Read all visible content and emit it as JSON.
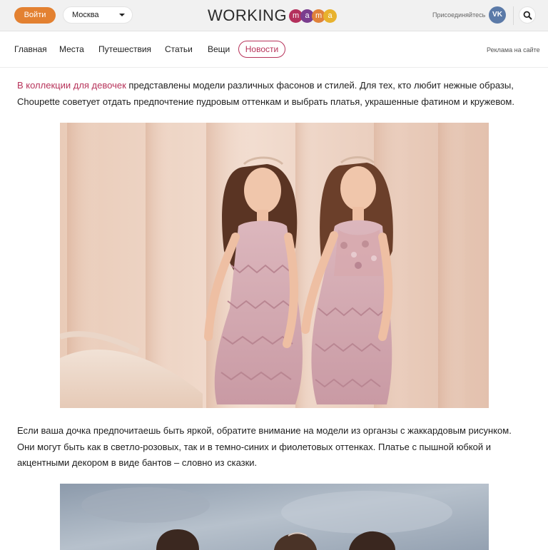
{
  "header": {
    "login_label": "Войти",
    "city_value": "Москва",
    "logo_word": "WORKING",
    "logo_letters": [
      "m",
      "a",
      "m",
      "a"
    ],
    "logo_colors": [
      "#b4305c",
      "#7a3d8e",
      "#e0823a",
      "#e8b22e"
    ],
    "join_label": "Присоединяйтесь",
    "vk_label": "VK"
  },
  "nav": {
    "items": [
      "Главная",
      "Места",
      "Путешествия",
      "Статьи",
      "Вещи"
    ],
    "active": "Новости",
    "ad_link": "Реклама на сайте"
  },
  "article": {
    "p1_link": "В коллекции для девочек",
    "p1_line1_rest": " представлены модели различных фасонов и стилей. Для тех, кто любит нежные образы,",
    "p1_line2": "Choupette советует отдать предпочтение пудровым оттенкам и выбрать платья, украшенные фатином и кружевом.",
    "p2_line1": "Если ваша дочка предпочитаешь быть яркой, обратите внимание на модели из органзы с жаккардовым рисунком.",
    "p2_line2": "Они могут быть как в светло-розовых, так и в темно-синих и фиолетовых оттенках. Платье с пышной юбкой и",
    "p2_line3": "акцентными декором в виде бантов – словно из сказки."
  },
  "colors": {
    "accent": "#b7335a",
    "login": "#e38131",
    "vk": "#5b7aa8"
  }
}
